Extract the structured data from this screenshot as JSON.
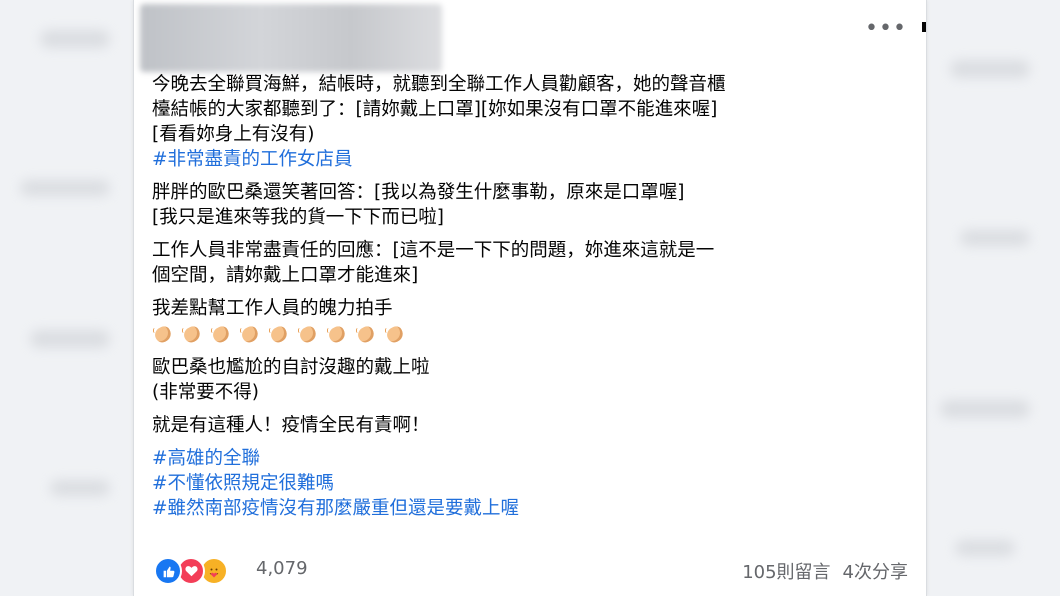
{
  "post": {
    "more_icon": "•••",
    "paragraphs": [
      {
        "lines": [
          "今晚去全聯買海鮮，結帳時，就聽到全聯工作人員勸顧客，她的聲音櫃",
          "檯結帳的大家都聽到了：[請妳戴上口罩][妳如果沒有口罩不能進來喔]",
          "[看看妳身上有沒有)"
        ],
        "tags": [
          "#非常盡責的工作女店員"
        ]
      },
      {
        "lines": [
          "胖胖的歐巴桑還笑著回答：[我以為發生什麼事勒，原來是口罩喔]",
          "[我只是進來等我的貨一下下而已啦]"
        ]
      },
      {
        "lines": [
          "工作人員非常盡責任的回應：[這不是一下下的問題，妳進來這就是一",
          "個空間，請妳戴上口罩才能進來]"
        ]
      },
      {
        "lines": [
          "我差點幫工作人員的魄力拍手"
        ],
        "clap_count": 9
      },
      {
        "lines": [
          "歐巴桑也尷尬的自討沒趣的戴上啦",
          "(非常要不得)"
        ]
      },
      {
        "lines": [
          "就是有這種人！疫情全民有責啊！"
        ]
      },
      {
        "tags": [
          "#高雄的全聯",
          "#不懂依照規定很難嗎",
          "#雖然南部疫情沒有那麼嚴重但還是要戴上喔"
        ]
      }
    ]
  },
  "footer": {
    "reactions": [
      {
        "name": "like",
        "color": "#1877f2"
      },
      {
        "name": "love",
        "color": "#f33e58"
      },
      {
        "name": "care",
        "color": "#f7b125"
      }
    ],
    "reaction_count": "4,079",
    "comments": "105則留言",
    "shares": "4次分享"
  },
  "colors": {
    "hashtag": "#216fdb",
    "text": "#050505",
    "muted": "#65676b"
  }
}
